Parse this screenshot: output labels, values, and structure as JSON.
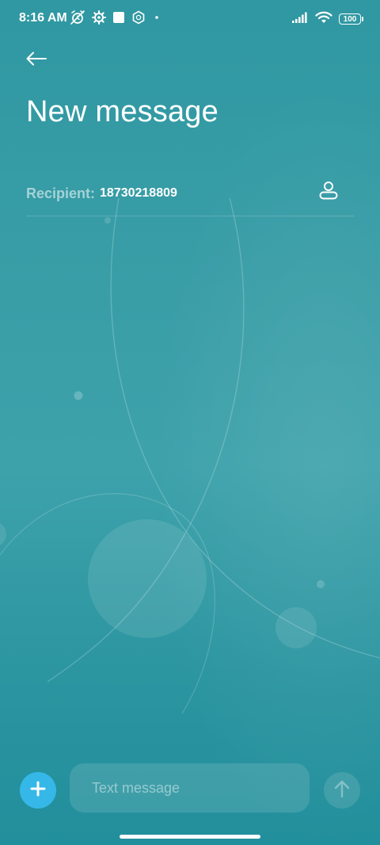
{
  "status_bar": {
    "time": "8:16 AM",
    "battery_level": "100",
    "left_icons": [
      "alarm-off-icon",
      "settings-gear-icon",
      "square-notification-icon",
      "hexagon-app-icon",
      "dot-icon"
    ],
    "right_icons": [
      "signal-strength-icon",
      "wifi-icon",
      "battery-icon"
    ]
  },
  "header": {
    "title": "New message",
    "back_icon": "arrow-left-icon"
  },
  "recipient": {
    "label": "Recipient:",
    "value": "18730218809",
    "contact_icon": "person-icon"
  },
  "composer": {
    "placeholder": "Text message",
    "attach_icon": "plus-icon",
    "send_icon": "arrow-up-icon"
  },
  "colors": {
    "background": "#3a9ea7",
    "accent": "#35b7e8",
    "text_primary": "#ffffff"
  }
}
